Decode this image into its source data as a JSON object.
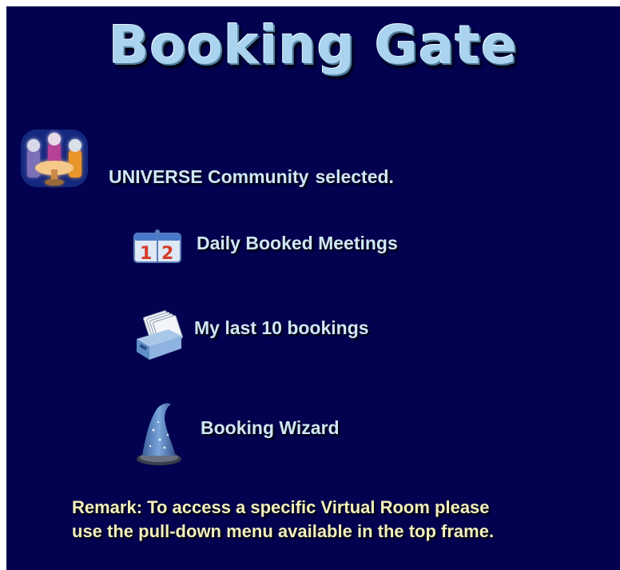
{
  "header": {
    "title": "Booking Gate"
  },
  "community": {
    "name": "UNIVERSE Community",
    "status": "selected.",
    "icon": "community-group-icon"
  },
  "menu": {
    "items": [
      {
        "label": "Daily Booked Meetings",
        "icon": "calendar-icon"
      },
      {
        "label": "My last 10 bookings",
        "icon": "file-drawer-icon"
      },
      {
        "label": "Booking Wizard",
        "icon": "wizard-hat-icon"
      }
    ]
  },
  "remark": {
    "line1": "Remark: To access a specific Virtual Room please",
    "line2": "use the pull-down menu available in the top frame."
  },
  "colors": {
    "background": "#020250",
    "title": "#a9d3ee",
    "label": "#cfe6f8",
    "remark": "#f2efbd"
  }
}
